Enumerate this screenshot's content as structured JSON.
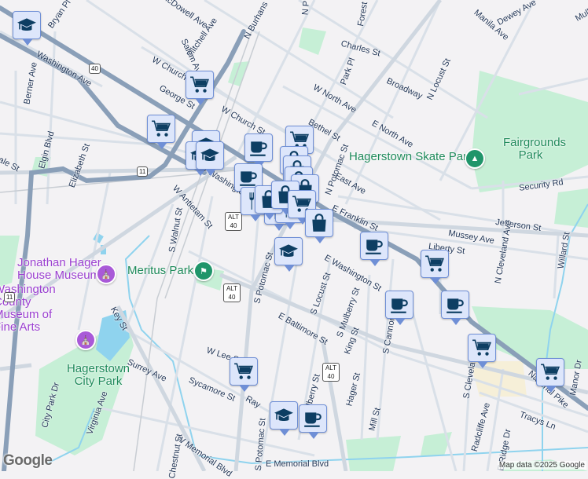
{
  "map": {
    "attribution": "Map data ©2025 Google",
    "logo": "Google",
    "colors": {
      "background": "#f3f2f4",
      "park": "#c6efd6",
      "water": "#8fd3ee",
      "highway": "#8a9fb8",
      "road": "#d6dde6",
      "marker_bg": "#dde6fb",
      "marker_icon": "#0d3e63"
    },
    "street_labels": [
      "Bryan Pl",
      "McDowell Ave",
      "Mitchell Ave",
      "N Burhans",
      "Salem Ave",
      "W Church St",
      "George St",
      "W Church St",
      "Washington Ave",
      "Berner Ave",
      "Elgin Blvd",
      "Elizabeth St",
      "vale St",
      "W Washington St",
      "W Antietam St",
      "S Walnut St",
      "Key St",
      "Surrey Ave",
      "City Park Dr",
      "Virginia Ave",
      "W Lee St",
      "Sycamore St",
      "S Potomac St",
      "E Baltimore St",
      "S Locust St",
      "S Mulberry St",
      "King St",
      "Hager St",
      "Mill St",
      "S Cannon Ave",
      "E Washington St",
      "E Franklin St",
      "Liberty St",
      "Mussey Ave",
      "Jefferson St",
      "N Cleveland Ave",
      "Willard St",
      "Security Rd",
      "E North Ave",
      "W North Ave",
      "Broadway",
      "N Locust St",
      "Charles St",
      "Park Pl",
      "Manila Ave",
      "Dewey Ave",
      "Bethel St",
      "N Potomac St",
      "East Ave",
      "National Pike",
      "S Cleveland Ave",
      "Radcliffe Ave",
      "E Ridge Dr",
      "Tracys Ln",
      "Manor Dr",
      "W Memorial Blvd",
      "E Memorial Blvd",
      "S Mulberry St",
      "Ray",
      "Chestnut St",
      "S Potomac St",
      "Forest",
      "N P",
      "Mulberry"
    ],
    "places": [
      {
        "name": "Jonathan Hager House Museum",
        "kind": "museum"
      },
      {
        "name": "Washington County Museum of Fine Arts",
        "kind": "museum"
      },
      {
        "name": "Meritus Park",
        "kind": "stadium"
      },
      {
        "name": "Hagerstown City Park",
        "kind": "park"
      },
      {
        "name": "Hagerstown Skate Park",
        "kind": "park"
      },
      {
        "name": "Fairgrounds Park",
        "kind": "park"
      }
    ],
    "shields": [
      "40",
      "11",
      "ALT 40",
      "ALT 40",
      "ALT 40"
    ],
    "markers": [
      "school",
      "cart",
      "cart",
      "school",
      "school",
      "school",
      "coffee",
      "coffee",
      "cart",
      "bag",
      "bag",
      "bag",
      "bag",
      "cutlery",
      "cutlery",
      "cutlery",
      "bag",
      "bag",
      "cart",
      "bag",
      "coffee",
      "cart",
      "coffee",
      "coffee",
      "cart",
      "cart",
      "school",
      "cart",
      "school",
      "coffee"
    ]
  }
}
